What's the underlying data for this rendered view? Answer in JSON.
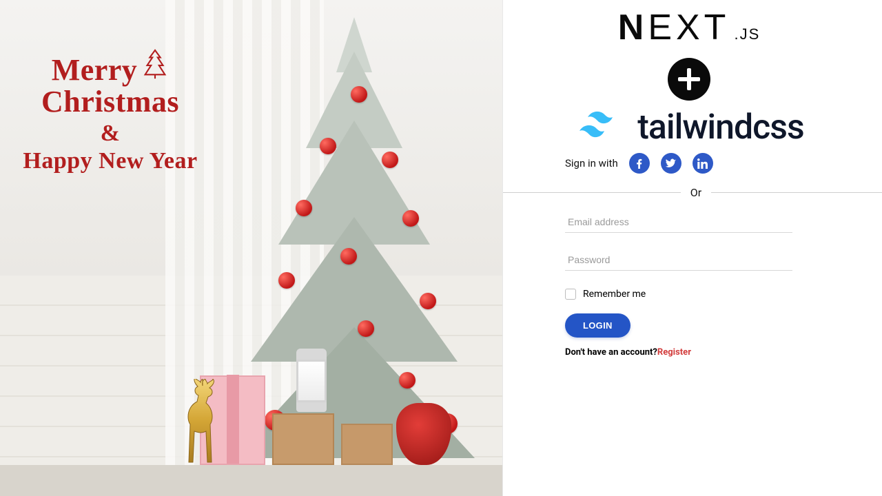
{
  "greeting": {
    "line1": "Merry",
    "line2": "Christmas",
    "amp": "&",
    "line3": "Happy New Year"
  },
  "logos": {
    "nextjs_prefix": "N",
    "nextjs_mid": "EXT",
    "nextjs_suffix": ".JS",
    "tailwind": "tailwindcss"
  },
  "form": {
    "sign_in_label": "Sign in with",
    "divider_text": "Or",
    "email_placeholder": "Email address",
    "password_placeholder": "Password",
    "remember_label": "Remember me",
    "login_button": "LOGIN",
    "no_account_text": "Don't have an account?",
    "register_link": "Register"
  },
  "colors": {
    "greeting_red": "#b21e1e",
    "social_blue": "#2e59c7",
    "login_blue": "#2455c6",
    "register_red": "#d23c3c",
    "tailwind_cyan": "#38bdf8"
  }
}
